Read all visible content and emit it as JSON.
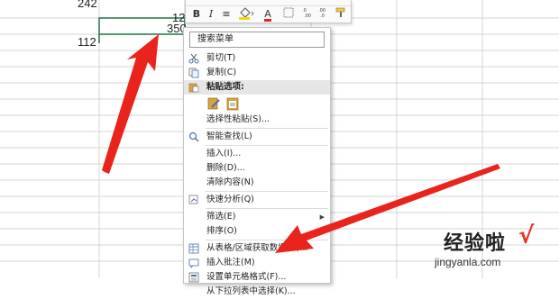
{
  "cells": {
    "a_top": "242",
    "b_top": "12",
    "b_second": "350",
    "a_third": "112"
  },
  "toolbar": {
    "bold": "B",
    "italic": "I",
    "align": "≡",
    "font_color_label": "A"
  },
  "menu": {
    "search_label": "搜索菜单",
    "items": [
      {
        "label": "剪切(T)",
        "icon": "scissors-icon"
      },
      {
        "label": "复制(C)",
        "icon": "copy-icon"
      },
      {
        "label": "粘贴选项:",
        "icon": "paste-icon"
      },
      {
        "label": "选择性粘贴(S)...",
        "icon": ""
      },
      {
        "label": "智能查找(L)",
        "icon": "smart-lookup-icon"
      },
      {
        "label": "插入(I)...",
        "icon": ""
      },
      {
        "label": "删除(D)...",
        "icon": ""
      },
      {
        "label": "清除内容(N)",
        "icon": ""
      },
      {
        "label": "快速分析(Q)",
        "icon": "quick-analysis-icon"
      },
      {
        "label": "筛选(E)",
        "icon": ""
      },
      {
        "label": "排序(O)",
        "icon": ""
      },
      {
        "label": "从表格/区域获取数据(G)...",
        "icon": "table-icon"
      },
      {
        "label": "插入批注(M)",
        "icon": "comment-icon"
      },
      {
        "label": "设置单元格格式(F)...",
        "icon": "format-cells-icon"
      },
      {
        "label": "从下拉列表中选择(K)...",
        "icon": ""
      }
    ]
  },
  "watermark": {
    "main": "经验啦",
    "check": "√",
    "sub": "jingyanla.com"
  },
  "colors": {
    "arrow": "#e8241c",
    "selection_border": "#217346",
    "font_color": "#e8241c",
    "highlight": "#f5d90a"
  }
}
